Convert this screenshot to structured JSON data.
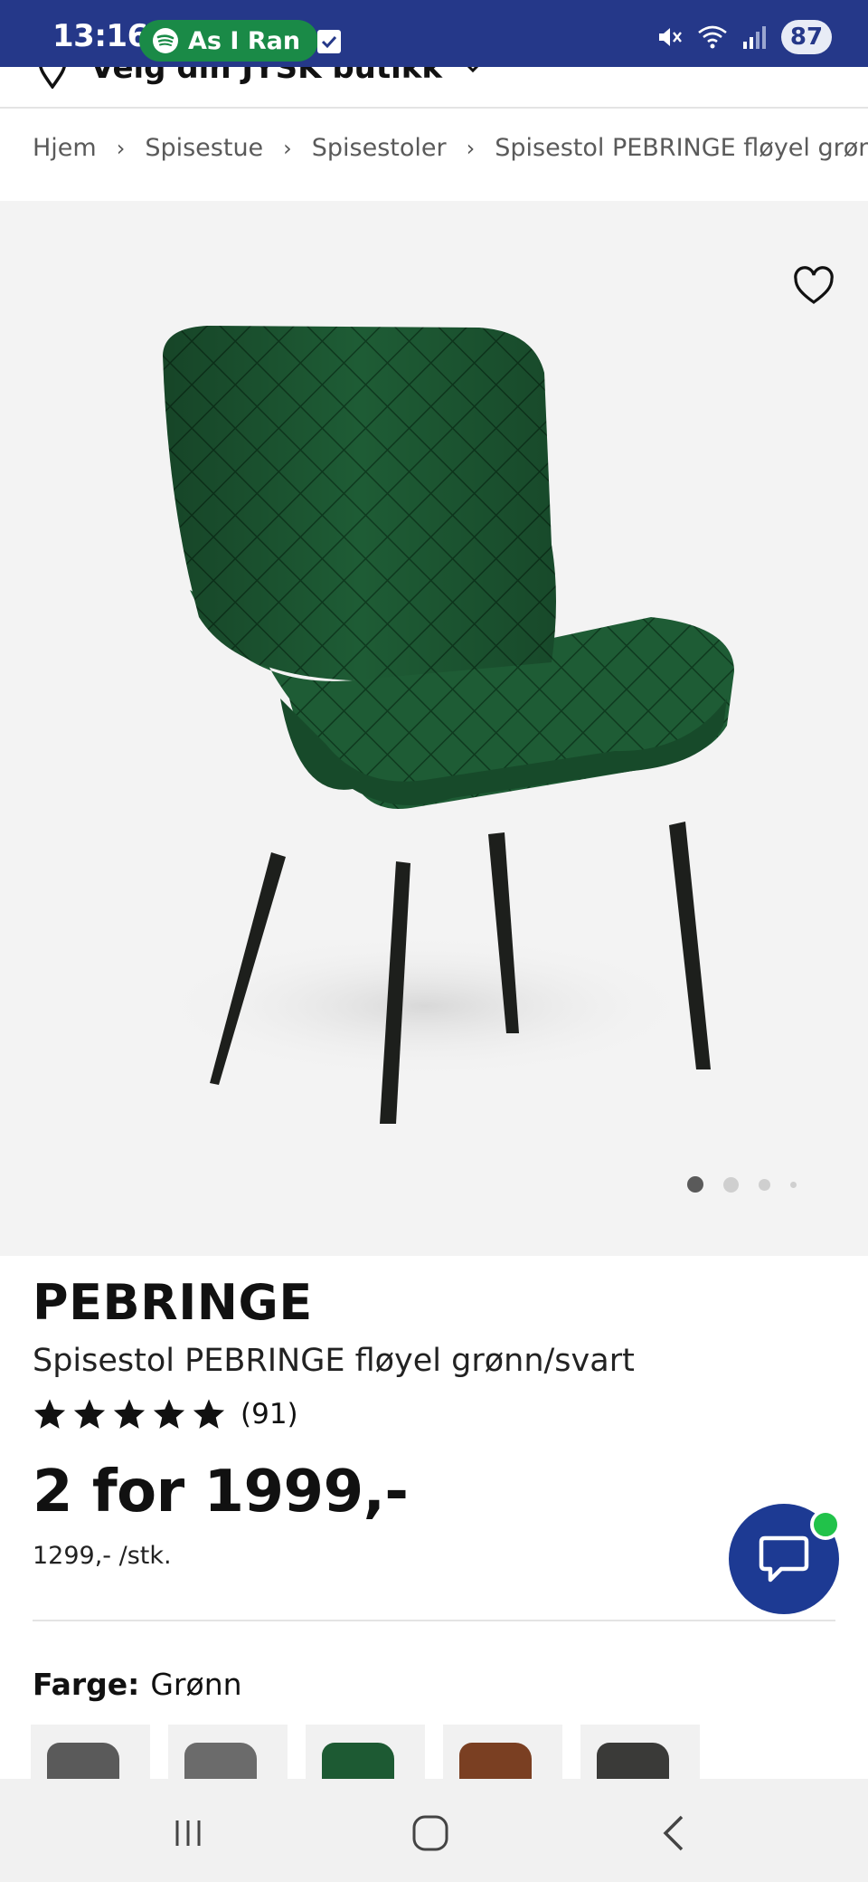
{
  "status_bar": {
    "time": "13:16",
    "media_label": "As I Ran",
    "battery": "87"
  },
  "store_selector": {
    "label": "Velg din JYSK butikk"
  },
  "breadcrumb": {
    "items": [
      "Hjem",
      "Spisestue",
      "Spisestoler",
      "Spisestol PEBRINGE fløyel grøn"
    ]
  },
  "gallery": {
    "image_count": 4,
    "active_index": 0
  },
  "product": {
    "brand": "PEBRINGE",
    "name": "Spisestol PEBRINGE fløyel grønn/svart",
    "rating_stars": 5,
    "review_count": "(91)",
    "price": "2 for 1999,-",
    "unit_price": "1299,- /stk."
  },
  "color": {
    "label": "Farge:",
    "value": "Grønn",
    "options": [
      "Grå",
      "Grå",
      "Grønn",
      "Brun",
      "Svart"
    ]
  },
  "colors": {
    "header": "#253889",
    "spotify_pill": "#1a8a47",
    "chat_button": "#1d3a93",
    "chat_online": "#21c24a",
    "chair_green": "#1d5a33"
  }
}
